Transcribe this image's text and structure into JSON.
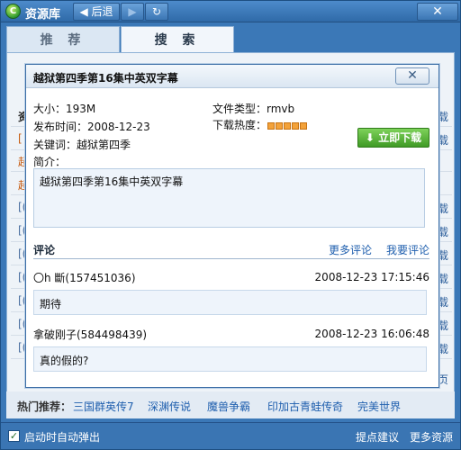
{
  "app": {
    "title": "资源库",
    "logo_letter": "C",
    "back_label": "◀ 后退",
    "forward_icon": "▶",
    "refresh_icon": "↻",
    "close_icon": "✕"
  },
  "tabs": [
    {
      "label": "推 荐",
      "active": false
    },
    {
      "label": "搜 索",
      "active": true
    }
  ],
  "background_list": {
    "header_left": "资",
    "header_right": "载",
    "rows": [
      {
        "left": "[",
        "right": "载"
      },
      {
        "left": "起",
        "right": ""
      },
      {
        "left": "起",
        "right": ""
      },
      {
        "left": "[(",
        "right": "载"
      },
      {
        "left": "[(",
        "right": "载"
      },
      {
        "left": "[(",
        "right": "载"
      },
      {
        "left": "[(",
        "right": "载"
      },
      {
        "left": "[(",
        "right": "载"
      },
      {
        "left": "[(",
        "right": "载"
      },
      {
        "left": "[(",
        "right": "载"
      },
      {
        "left": "",
        "right": "页"
      }
    ]
  },
  "dialog": {
    "title": "越狱第四季第16集中英双字幕",
    "close_icon": "✕",
    "size": "大小：193M",
    "publish_time": "发布时间：2008-12-23",
    "keywords": "关键词：越狱第四季",
    "intro_label": "简介：",
    "file_type": "文件类型：rmvb",
    "heat_label": "下载热度：",
    "heat_level": 5,
    "heat_max": 5,
    "download_button": "⬇ 立即下载",
    "description": "越狱第四季第16集中英双字幕",
    "comments_title": "评论",
    "more_comments": "更多评论",
    "write_comment": "我要评论",
    "comments": [
      {
        "author": "〇h 斷(157451036)",
        "time": "2008-12-23 17:15:46",
        "text": "期待"
      },
      {
        "author": "拿破刚子(584498439)",
        "time": "2008-12-23 16:06:48",
        "text": "真的假的?"
      }
    ]
  },
  "hot": {
    "label": "热门推荐：",
    "items": [
      "三国群英传7",
      "深渊传说",
      "魔兽争霸",
      "印加古青蛙传奇",
      "完美世界"
    ]
  },
  "status": {
    "check_mark": "✓",
    "auto_popup": "启动时自动弹出",
    "suggest": "提点建议",
    "more_resources": "更多资源"
  },
  "colors": {
    "window_blue": "#3b78b7",
    "link_blue": "#1f5fae",
    "download_green": "#3f9a25",
    "heat_orange": "#f3a23a"
  }
}
